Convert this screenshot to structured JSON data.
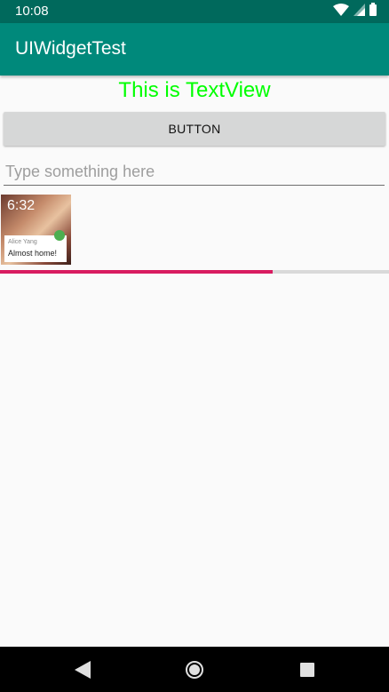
{
  "status_bar": {
    "time": "10:08",
    "icons": [
      "wifi-icon",
      "signal-icon",
      "battery-icon"
    ]
  },
  "app_bar": {
    "title": "UIWidgetTest"
  },
  "textview": {
    "text": "This is TextView",
    "color": "#00ff00"
  },
  "button": {
    "label": "BUTTON"
  },
  "edit_text": {
    "value": "",
    "placeholder": "Type something here"
  },
  "image": {
    "time": "6:32",
    "sender": "Alice Yang",
    "message": "Almost home!"
  },
  "progress": {
    "value": 70,
    "color": "#d81b60"
  },
  "nav_bar": {
    "icons": [
      "back-icon",
      "home-icon",
      "recents-icon"
    ]
  },
  "colors": {
    "status_bar": "#00695c",
    "app_bar": "#00897b",
    "background": "#fafafa"
  }
}
